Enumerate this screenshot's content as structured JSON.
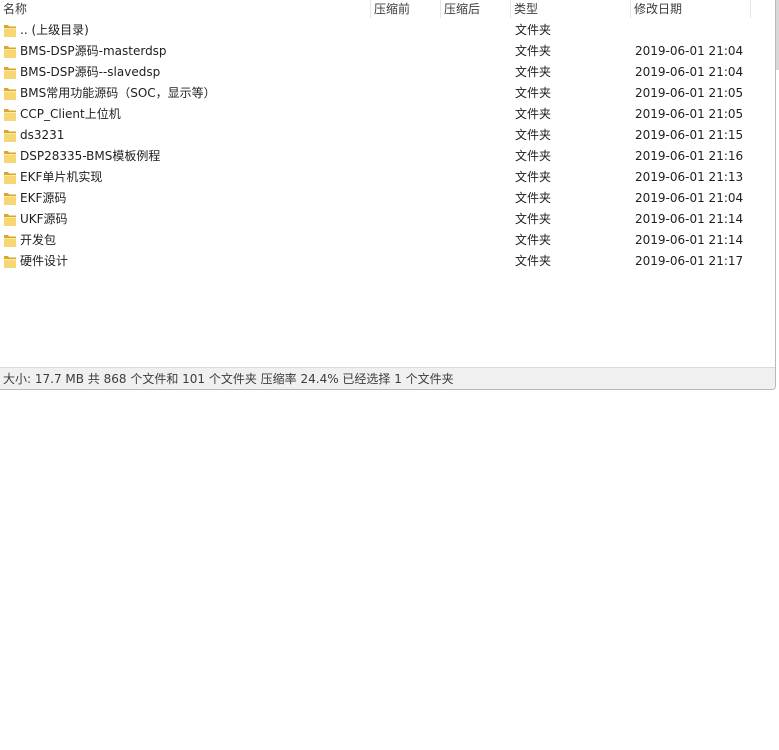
{
  "columns": {
    "name": "名称",
    "before": "压缩前",
    "after": "压缩后",
    "type": "类型",
    "modified": "修改日期"
  },
  "rows": [
    {
      "name": ".. (上级目录)",
      "type": "文件夹",
      "modified": ""
    },
    {
      "name": "BMS-DSP源码-masterdsp",
      "type": "文件夹",
      "modified": "2019-06-01 21:04"
    },
    {
      "name": "BMS-DSP源码--slavedsp",
      "type": "文件夹",
      "modified": "2019-06-01 21:04"
    },
    {
      "name": "BMS常用功能源码（SOC，显示等）",
      "type": "文件夹",
      "modified": "2019-06-01 21:05"
    },
    {
      "name": "CCP_Client上位机",
      "type": "文件夹",
      "modified": "2019-06-01 21:05"
    },
    {
      "name": "ds3231",
      "type": "文件夹",
      "modified": "2019-06-01 21:15"
    },
    {
      "name": "DSP28335-BMS模板例程",
      "type": "文件夹",
      "modified": "2019-06-01 21:16"
    },
    {
      "name": "EKF单片机实现",
      "type": "文件夹",
      "modified": "2019-06-01 21:13"
    },
    {
      "name": "EKF源码",
      "type": "文件夹",
      "modified": "2019-06-01 21:04"
    },
    {
      "name": "UKF源码",
      "type": "文件夹",
      "modified": "2019-06-01 21:14"
    },
    {
      "name": "开发包",
      "type": "文件夹",
      "modified": "2019-06-01 21:14"
    },
    {
      "name": "硬件设计",
      "type": "文件夹",
      "modified": "2019-06-01 21:17"
    }
  ],
  "status": {
    "text": "大小: 17.7 MB 共 868 个文件和 101 个文件夹 压缩率 24.4% 已经选择 1 个文件夹"
  },
  "icons": {
    "folder": "folder-icon"
  },
  "colors": {
    "folder_light": "#f7d774",
    "folder_dark": "#d9a72a",
    "statusbar_bg": "#f0f0f0"
  }
}
